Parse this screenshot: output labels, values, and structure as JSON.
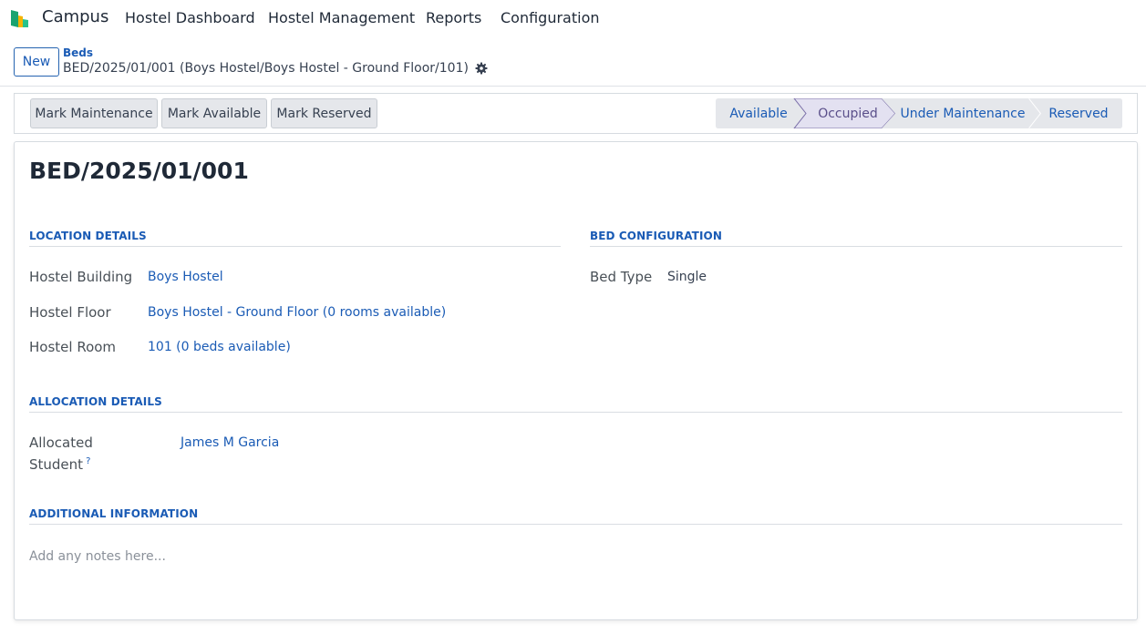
{
  "navbar": {
    "app_name": "Campus",
    "menu": [
      "Hostel Dashboard",
      "Hostel Management",
      "Reports",
      "Configuration"
    ]
  },
  "control_panel": {
    "new_label": "New",
    "breadcrumb_parent": "Beds",
    "breadcrumb_current": "BED/2025/01/001 (Boys Hostel/Boys Hostel - Ground Floor/101)"
  },
  "actions": {
    "mark_maintenance": "Mark Maintenance",
    "mark_available": "Mark Available",
    "mark_reserved": "Mark Reserved"
  },
  "stages": [
    {
      "label": "Available",
      "active": false
    },
    {
      "label": "Occupied",
      "active": true
    },
    {
      "label": "Under Maintenance",
      "active": false
    },
    {
      "label": "Reserved",
      "active": false
    }
  ],
  "record": {
    "title": "BED/2025/01/001",
    "sections": {
      "location": "LOCATION DETAILS",
      "bed_config": "BED CONFIGURATION",
      "allocation": "ALLOCATION DETAILS",
      "additional": "ADDITIONAL INFORMATION"
    },
    "fields": {
      "hostel_building_label": "Hostel Building",
      "hostel_building_value": "Boys Hostel",
      "hostel_floor_label": "Hostel Floor",
      "hostel_floor_value": "Boys Hostel - Ground Floor (0 rooms available)",
      "hostel_room_label": "Hostel Room",
      "hostel_room_value": "101 (0 beds available)",
      "bed_type_label": "Bed Type",
      "bed_type_value": "Single",
      "allocated_student_label_1": "Allocated",
      "allocated_student_label_2": "Student",
      "allocated_student_help": "?",
      "allocated_student_value": "James M Garcia"
    },
    "notes_placeholder": "Add any notes here..."
  },
  "colors": {
    "link": "#1a5bb5",
    "active_stage_bg": "#e3e1f1",
    "active_stage_border": "#7a6fa8",
    "stage_bg": "#e5e7eb"
  }
}
